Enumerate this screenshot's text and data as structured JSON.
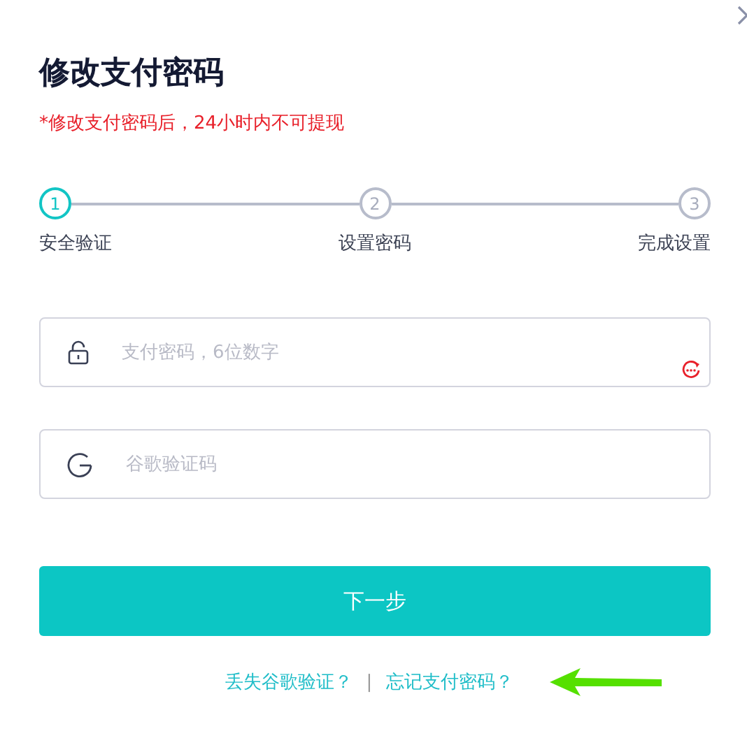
{
  "title": "修改支付密码",
  "notice": "*修改支付密码后，24小时内不可提现",
  "steps": [
    {
      "number": "1",
      "label": "安全验证",
      "selected": true
    },
    {
      "number": "2",
      "label": "设置密码",
      "selected": false
    },
    {
      "number": "3",
      "label": "完成设置",
      "selected": false
    }
  ],
  "fields": [
    {
      "kind": "password",
      "placeholder": "支付密码，6位数字"
    },
    {
      "kind": "google",
      "placeholder": "谷歌验证码"
    }
  ],
  "submit_button": "下一步",
  "links": [
    "丢失谷歌验证？",
    "忘记支付密码？"
  ],
  "separator": "|"
}
